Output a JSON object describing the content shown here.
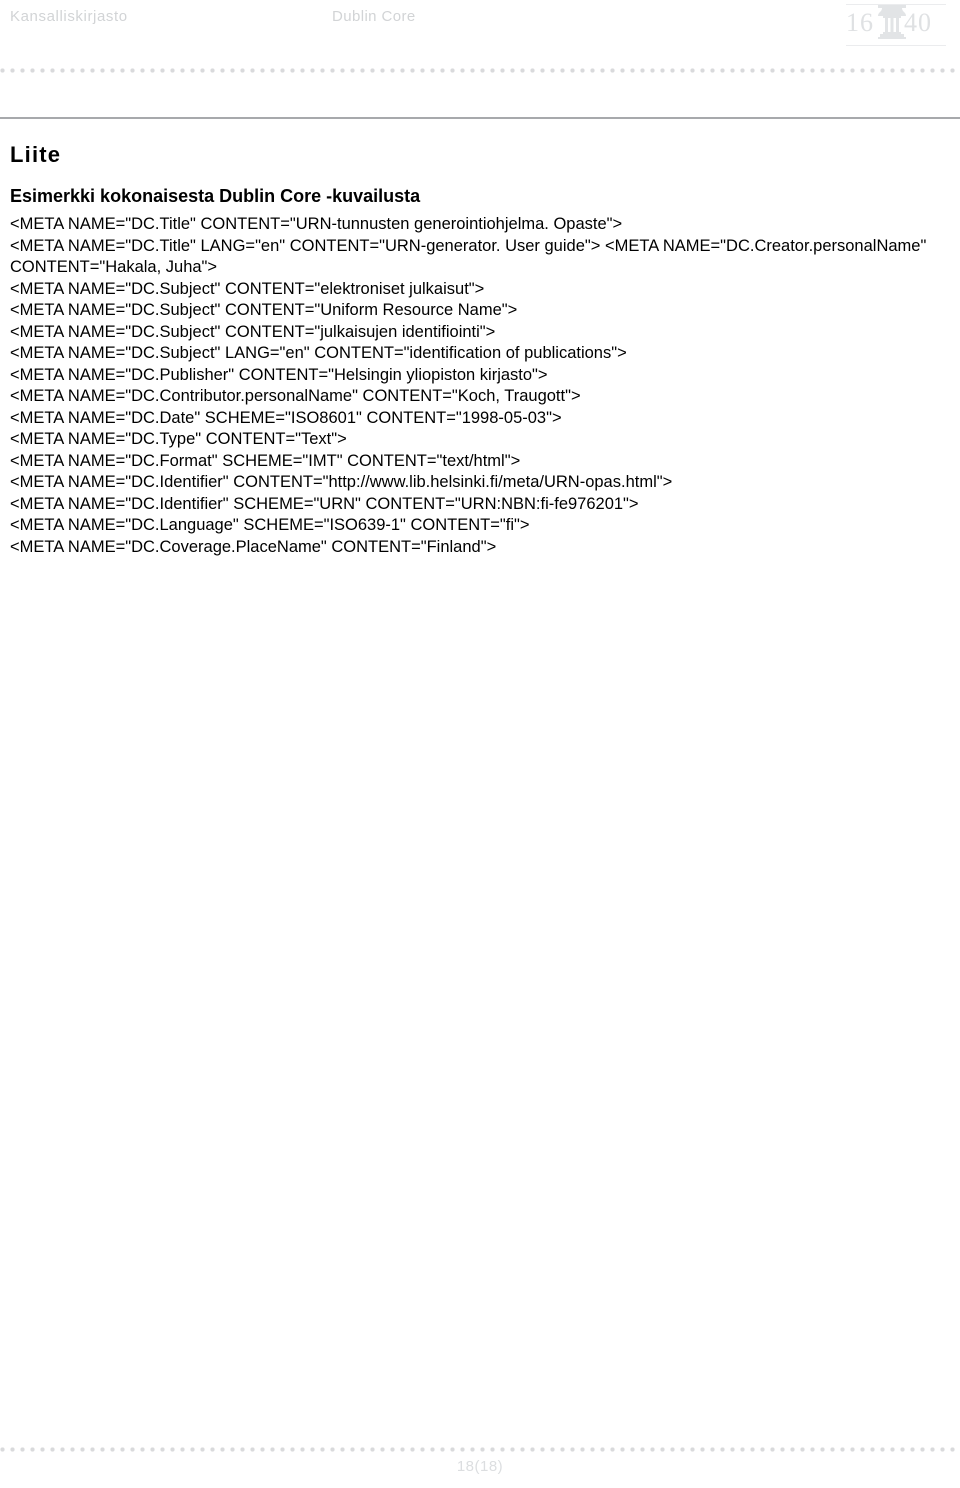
{
  "header": {
    "organization": "Kansalliskirjasto",
    "document_name": "Dublin Core",
    "logo": {
      "name": "national-library-1640-logo",
      "year_left": "16",
      "year_right": "40",
      "full_year": "1640"
    }
  },
  "content": {
    "title": "Liite",
    "subtitle": "Esimerkki kokonaisesta Dublin Core -kuvailusta",
    "metadata_example": "<META NAME=\"DC.Title\" CONTENT=\"URN-tunnusten generointiohjelma. Opaste\">\n<META NAME=\"DC.Title\" LANG=\"en\" CONTENT=\"URN-generator. User guide\"> <META NAME=\"DC.Creator.personalName\" CONTENT=\"Hakala, Juha\">\n<META NAME=\"DC.Subject\" CONTENT=\"elektroniset julkaisut\">\n<META NAME=\"DC.Subject\" CONTENT=\"Uniform Resource Name\">\n<META NAME=\"DC.Subject\" CONTENT=\"julkaisujen identifiointi\">\n<META NAME=\"DC.Subject\" LANG=\"en\" CONTENT=\"identification of publications\">\n<META NAME=\"DC.Publisher\" CONTENT=\"Helsingin yliopiston kirjasto\">\n<META NAME=\"DC.Contributor.personalName\" CONTENT=\"Koch, Traugott\">\n<META NAME=\"DC.Date\" SCHEME=\"ISO8601\" CONTENT=\"1998-05-03\">\n<META NAME=\"DC.Type\" CONTENT=\"Text\">\n<META NAME=\"DC.Format\" SCHEME=\"IMT\" CONTENT=\"text/html\">\n<META NAME=\"DC.Identifier\" CONTENT=\"http://www.lib.helsinki.fi/meta/URN-opas.html\">\n<META NAME=\"DC.Identifier\" SCHEME=\"URN\" CONTENT=\"URN:NBN:fi-fe976201\">\n<META NAME=\"DC.Language\" SCHEME=\"ISO639-1\" CONTENT=\"fi\">\n<META NAME=\"DC.Coverage.PlaceName\" CONTENT=\"Finland\">"
  },
  "footer": {
    "page_number": "18(18)"
  },
  "colors": {
    "header_text": "#d2d4d6",
    "rule": "#a7a9ac",
    "dots": "#d9dadc",
    "body_text": "#000000",
    "footer_text": "#dcdee0"
  }
}
